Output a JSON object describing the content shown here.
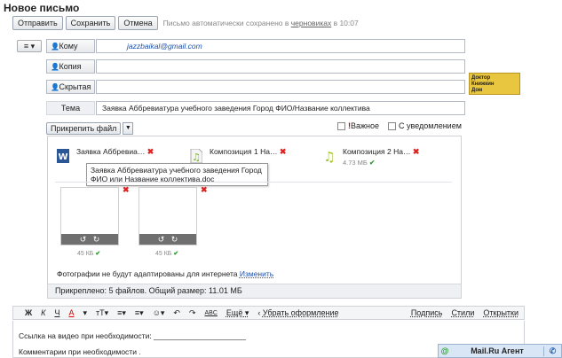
{
  "page": {
    "title": "Новое письмо"
  },
  "toolbar": {
    "send_label": "Отправить",
    "save_label": "Сохранить",
    "cancel_label": "Отмена",
    "autosave_prefix": "Письмо автоматически сохранено в ",
    "autosave_link": "черновиках",
    "autosave_time": " в 10:07"
  },
  "form": {
    "menu_label": "≡ ▾",
    "to_label": "Кому",
    "to_value": "jazzbaikal@gmail.com",
    "cc_label": "Копия",
    "cc_value": "",
    "bcc_label": "Скрытая",
    "bcc_value": "",
    "subject_label": "Тема",
    "subject_value": "Заявка Аббревиатура учебного заведения Город ФИО/Название коллектива"
  },
  "attach": {
    "button_label": "Прикрепить файл",
    "important_label": "Важное",
    "notify_label": "С уведомлением",
    "files": [
      {
        "name": "Заявка Аббревиа…",
        "size": ""
      },
      {
        "name": "Композиция 1 На…",
        "size": ""
      },
      {
        "name": "Композиция 2 На…",
        "size": "4.73 МБ"
      }
    ],
    "tooltip": "Заявка Аббревиатура учебного заведения Город ФИО или Название коллектива.doc",
    "photos": [
      {
        "size": "45 КБ"
      },
      {
        "size": "45 КБ"
      }
    ],
    "photo_note": "Фотографии не будут адаптированы для интернета ",
    "photo_note_link": "Изменить",
    "summary": "Прикреплено: 5 файлов. Общий размер: 11.01 МБ"
  },
  "editor": {
    "toolbar": [
      "Ж",
      "К",
      "Ч",
      "А",
      "▾",
      "тТ▾",
      "≡▾",
      "≡▾",
      "☺▾",
      "↶",
      "↷",
      "ABC",
      "Ещё ▾"
    ],
    "remove_format": "Убрать оформление",
    "signature_label": "Подпись",
    "styles_label": "Стили",
    "postcards_label": "Открытки",
    "line1": "Ссылка на видео при необходимости: ______________________",
    "line2": "Комментарии при необходимости ."
  },
  "ad": {
    "line1": "Доктор",
    "line2": "Книжкин",
    "line3": "Дом"
  },
  "agent": {
    "at": "@",
    "label": "Mail.Ru Агент",
    "phone": "✆"
  }
}
